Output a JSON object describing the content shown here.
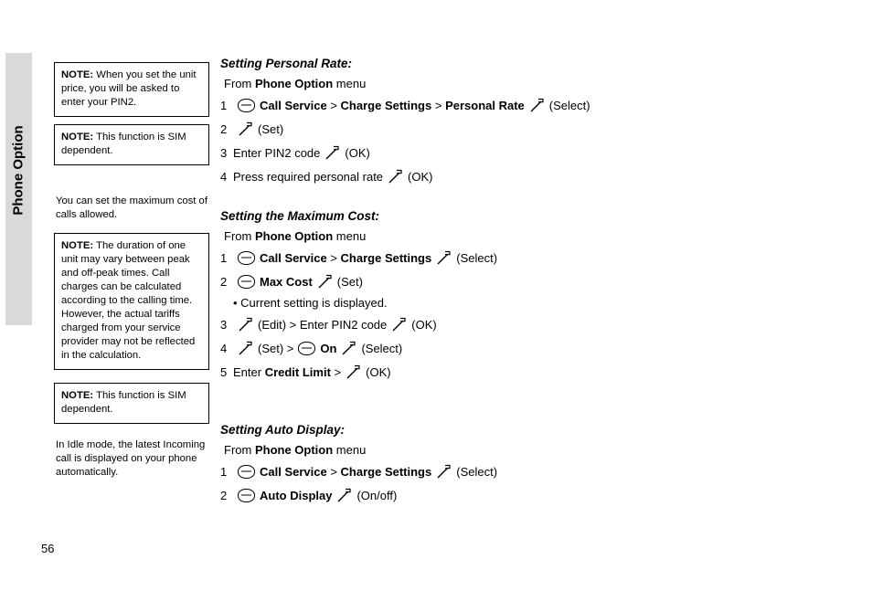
{
  "page": {
    "number": "56",
    "side_tab_label": "Phone Option"
  },
  "left_column": {
    "notes": [
      {
        "label": "NOTE:",
        "text": " When you set the unit price, you will be asked to enter your PIN2."
      },
      {
        "label": "NOTE:",
        "text": " This function is SIM dependent."
      },
      {
        "label": "NOTE:",
        "text": " The duration of one unit may vary between peak and off-peak times. Call charges can be calculated according to the calling time. However, the actual tariffs charged from your service provider may not be reflected in the calculation."
      },
      {
        "label": "NOTE:",
        "text": " This function is SIM dependent."
      }
    ],
    "paragraphs": [
      "You can set the maximum cost of calls allowed.",
      "In Idle mode, the latest Incoming call is displayed on your phone automatically."
    ]
  },
  "sections": [
    {
      "title": "Setting Personal Rate:",
      "from_prefix": "From ",
      "from_bold": "Phone Option",
      "from_suffix": " menu",
      "steps": [
        {
          "num": "1",
          "icon": "nav-key-icon",
          "parts": [
            {
              "text": "Call Service",
              "bold": true
            },
            {
              "text": " > ",
              "bold": false
            },
            {
              "text": "Charge Settings",
              "bold": true
            },
            {
              "text": " > ",
              "bold": false
            },
            {
              "text": "Personal Rate",
              "bold": true
            }
          ],
          "trailing_icon": "soft-key-icon",
          "trailing_text": "(Select)"
        },
        {
          "num": "2",
          "icon": "soft-key-icon",
          "parts": [],
          "trailing_icon": "",
          "trailing_text": "(Set)"
        },
        {
          "num": "3",
          "icon": "",
          "parts": [
            {
              "text": "Enter PIN2 code",
              "bold": false
            }
          ],
          "trailing_icon": "soft-key-icon",
          "trailing_text": "(OK)"
        },
        {
          "num": "4",
          "icon": "",
          "parts": [
            {
              "text": "Press required personal rate",
              "bold": false
            }
          ],
          "trailing_icon": "soft-key-icon",
          "trailing_text": "(OK)"
        }
      ]
    },
    {
      "title": "Setting the Maximum Cost:",
      "from_prefix": "From ",
      "from_bold": "Phone Option",
      "from_suffix": " menu",
      "steps": [
        {
          "num": "1",
          "icon": "nav-key-icon",
          "parts": [
            {
              "text": "Call Service",
              "bold": true
            },
            {
              "text": " > ",
              "bold": false
            },
            {
              "text": "Charge Settings",
              "bold": true
            }
          ],
          "trailing_icon": "soft-key-icon",
          "trailing_text": "(Select)"
        },
        {
          "num": "2",
          "icon": "nav-key-icon",
          "parts": [
            {
              "text": "Max Cost",
              "bold": true
            }
          ],
          "trailing_icon": "soft-key-icon",
          "trailing_text": "(Set)"
        }
      ],
      "bullet": "• Current setting is displayed.",
      "steps2": [
        {
          "num": "3",
          "icon": "soft-key-icon",
          "parts": [
            {
              "text": "(Edit) > Enter PIN2 code",
              "bold": false
            }
          ],
          "trailing_icon": "soft-key-icon",
          "trailing_text": "(OK)"
        },
        {
          "num": "4",
          "icon": "soft-key-icon",
          "parts": [
            {
              "text": "(Set) > ",
              "bold": false
            }
          ],
          "mid_icon": "nav-key-icon",
          "parts2": [
            {
              "text": "On",
              "bold": true
            }
          ],
          "trailing_icon": "soft-key-icon",
          "trailing_text": "(Select)"
        },
        {
          "num": "5",
          "icon": "",
          "parts": [
            {
              "text": "Enter ",
              "bold": false
            },
            {
              "text": "Credit Limit",
              "bold": true
            },
            {
              "text": " > ",
              "bold": false
            }
          ],
          "trailing_icon": "soft-key-icon",
          "trailing_text": "(OK)"
        }
      ]
    },
    {
      "title": "Setting Auto Display:",
      "from_prefix": "From ",
      "from_bold": "Phone Option",
      "from_suffix": " menu",
      "steps": [
        {
          "num": "1",
          "icon": "nav-key-icon",
          "parts": [
            {
              "text": "Call Service",
              "bold": true
            },
            {
              "text": " > ",
              "bold": false
            },
            {
              "text": "Charge Settings",
              "bold": true
            }
          ],
          "trailing_icon": "soft-key-icon",
          "trailing_text": "(Select)"
        },
        {
          "num": "2",
          "icon": "nav-key-icon",
          "parts": [
            {
              "text": "Auto Display",
              "bold": true
            }
          ],
          "trailing_icon": "soft-key-icon",
          "trailing_text": "(On/off)"
        }
      ]
    }
  ]
}
